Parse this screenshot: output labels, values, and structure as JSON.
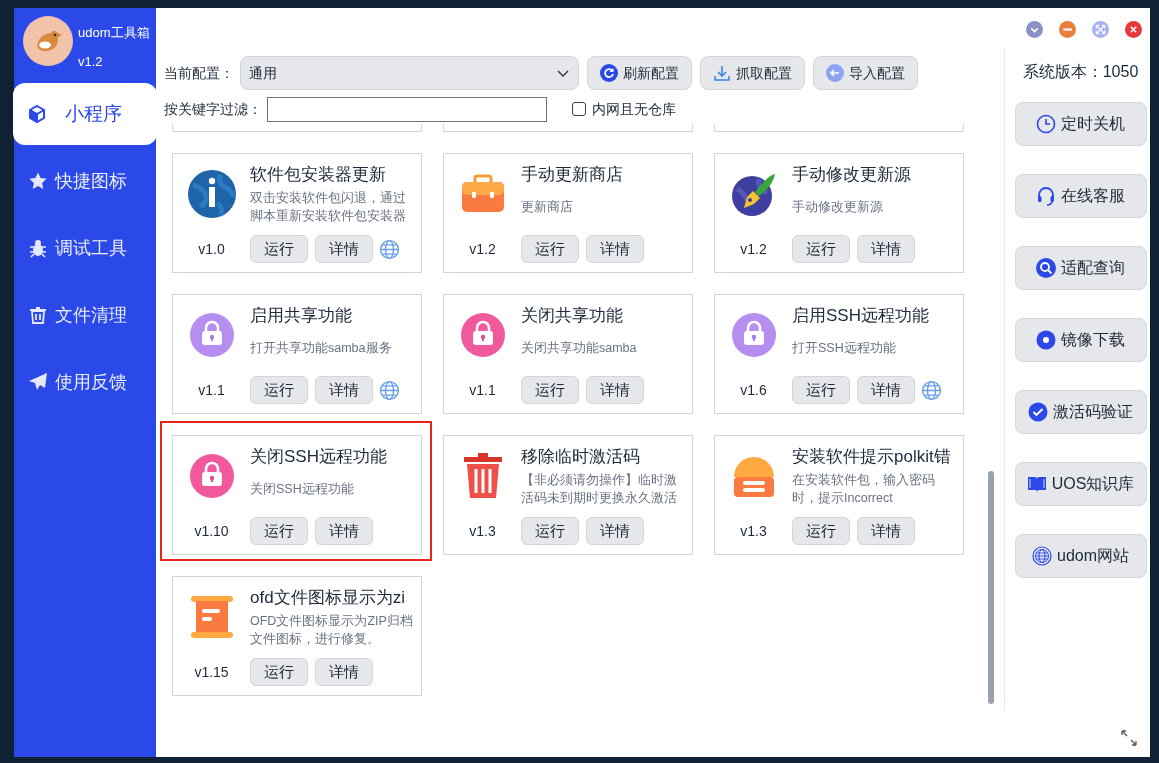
{
  "app": {
    "name": "udom工具箱",
    "version": "v1.2"
  },
  "sidebar": {
    "items": [
      {
        "label": "小程序",
        "kind": "cube",
        "selected": true
      },
      {
        "label": "快捷图标",
        "kind": "star",
        "selected": false
      },
      {
        "label": "调试工具",
        "kind": "bug",
        "selected": false
      },
      {
        "label": "文件清理",
        "kind": "trash",
        "selected": false
      },
      {
        "label": "使用反馈",
        "kind": "send",
        "selected": false
      }
    ]
  },
  "toolbar": {
    "config_label": "当前配置：",
    "config_value": "通用",
    "buttons": [
      {
        "label": "刷新配置",
        "kind": "refresh"
      },
      {
        "label": "抓取配置",
        "kind": "download"
      },
      {
        "label": "导入配置",
        "kind": "back"
      }
    ],
    "filter_label": "按关键字过滤：",
    "checkbox": {
      "label": "内网且无仓库",
      "checked": false
    }
  },
  "cards": [
    {
      "title": "软件包安装器更新",
      "description": "双击安装软件包闪退，通过脚本重新安装软件包安装器",
      "version": "v1.0",
      "kind": "globe-info",
      "web_link": true,
      "highlighted": false,
      "run": "运行",
      "details": "详情"
    },
    {
      "title": "手动更新商店",
      "description": "更新商店",
      "version": "v1.2",
      "kind": "briefcase",
      "web_link": false,
      "highlighted": false,
      "run": "运行",
      "details": "详情"
    },
    {
      "title": "手动修改更新源",
      "description": "手动修改更新源",
      "version": "v1.2",
      "kind": "pen-globe",
      "web_link": false,
      "highlighted": false,
      "run": "运行",
      "details": "详情"
    },
    {
      "title": "启用共享功能",
      "description": "打开共享功能samba服务",
      "version": "v1.1",
      "kind": "lock-purple",
      "web_link": true,
      "highlighted": false,
      "run": "运行",
      "details": "详情"
    },
    {
      "title": "关闭共享功能",
      "description": "关闭共享功能samba",
      "version": "v1.1",
      "kind": "lock-pink",
      "web_link": false,
      "highlighted": false,
      "run": "运行",
      "details": "详情"
    },
    {
      "title": "启用SSH远程功能",
      "description": "打开SSH远程功能",
      "version": "v1.6",
      "kind": "lock-purple",
      "web_link": true,
      "highlighted": false,
      "run": "运行",
      "details": "详情"
    },
    {
      "title": "关闭SSH远程功能",
      "description": "关闭SSH远程功能",
      "version": "v1.10",
      "kind": "lock-pink",
      "web_link": false,
      "highlighted": true,
      "run": "运行",
      "details": "详情"
    },
    {
      "title": "移除临时激活码",
      "description": "【非必须请勿操作】临时激活码未到期时更换永久激活",
      "version": "v1.3",
      "kind": "trash",
      "web_link": false,
      "highlighted": false,
      "run": "运行",
      "details": "详情"
    },
    {
      "title": "安装软件提示polkit错",
      "description": "在安装软件包，输入密码时，提示Incorrect",
      "version": "v1.3",
      "kind": "dome",
      "web_link": false,
      "highlighted": false,
      "run": "运行",
      "details": "详情"
    },
    {
      "title": "ofd文件图标显示为zi",
      "description": "OFD文件图标显示为ZIP归档文件图标，进行修复。",
      "version": "v1.15",
      "kind": "scroll",
      "web_link": false,
      "highlighted": false,
      "run": "运行",
      "details": "详情"
    }
  ],
  "right_panel": {
    "system_version": "系统版本：1050",
    "buttons": [
      {
        "label": "定时关机",
        "kind": "clock"
      },
      {
        "label": "在线客服",
        "kind": "headset"
      },
      {
        "label": "适配查询",
        "kind": "search"
      },
      {
        "label": "镜像下载",
        "kind": "disc"
      },
      {
        "label": "激活码验证",
        "kind": "check"
      },
      {
        "label": "UOS知识库",
        "kind": "book"
      },
      {
        "label": "udom网站",
        "kind": "www"
      }
    ]
  }
}
